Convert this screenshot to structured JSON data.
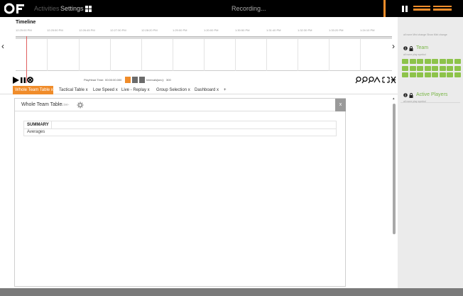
{
  "topbar": {
    "activities_label": "Activities",
    "settings_label": "Settings",
    "status_text": "Recording...",
    "icons": [
      "logo-icon",
      "grid-icon",
      "pause-icon",
      "audio-meter-icon"
    ]
  },
  "timeline": {
    "title": "Timeline",
    "ticks": [
      "12:25:00 PM",
      "12:25:50 PM",
      "12:26:45 PM",
      "12:27:30 PM",
      "12:28:20 PM",
      "1:29:00 PM",
      "1:20:00 PM",
      "1:30:50 PM",
      "1:31:40 PM",
      "1:32:30 PM",
      "1:33:20 PM",
      "1:24:10 PM"
    ],
    "playhead_time_label": "PlayHead Time:",
    "playhead_time_value": "00:00:00.000",
    "intervals_label": "Intervals[sec]:",
    "intervals_value": "300"
  },
  "tabs": [
    {
      "label": "Whole Team Table  x"
    },
    {
      "label": "Tactical Table  x"
    },
    {
      "label": "Low Speed  x"
    },
    {
      "label": "Live - Replay  x"
    },
    {
      "label": "Group Selection  x"
    },
    {
      "label": "Dashboard  x"
    },
    {
      "label": "+"
    }
  ],
  "panel": {
    "title": "Whole Team Table",
    "subtitle": "-Live-",
    "close_label": "x",
    "summary_header": "SUMMARY",
    "summary_row": "Averages"
  },
  "sidebar": {
    "filter_text": "all  none  Mini change  Show Mini change",
    "team": {
      "title": "Team",
      "sub": "all  none  play  symbol",
      "chip_count": 24
    },
    "active_players": {
      "title": "Active Players",
      "sub": "all  none  play  symbol"
    }
  },
  "colors": {
    "accent": "#f08c2a",
    "green": "#8dc34a",
    "topbar": "#000000"
  }
}
